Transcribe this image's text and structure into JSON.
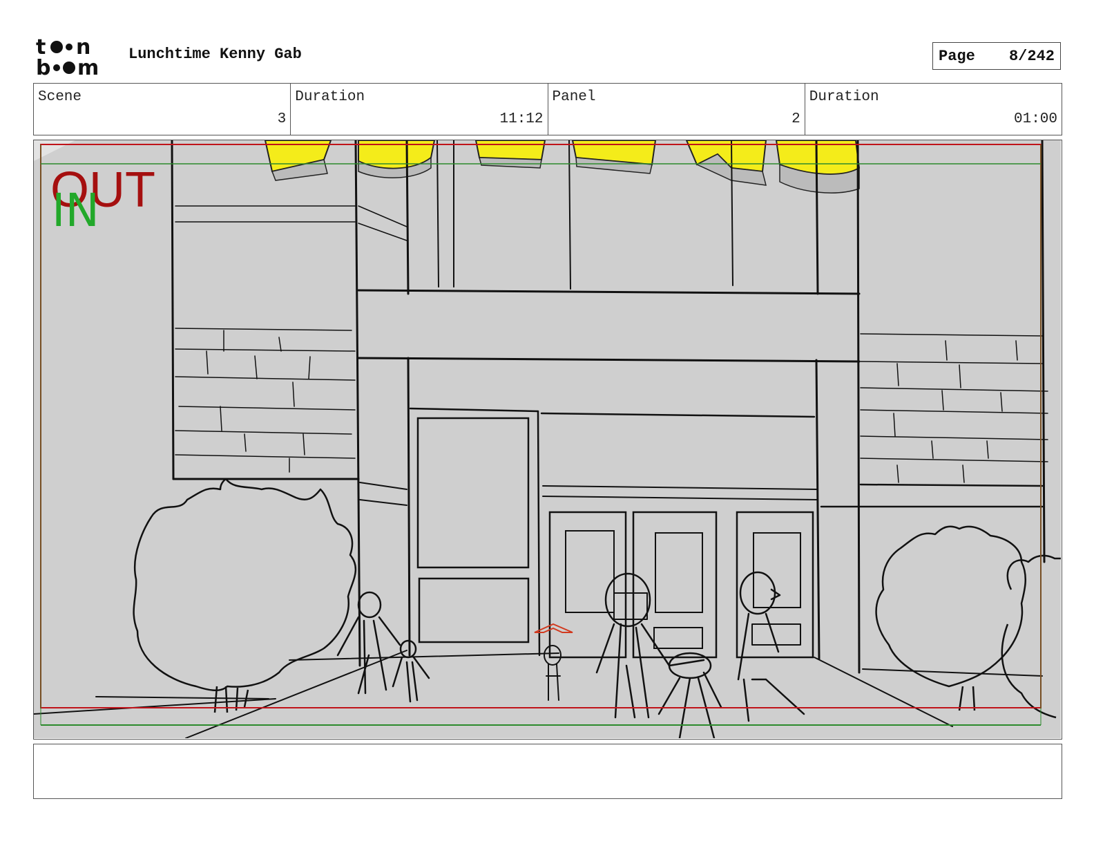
{
  "header": {
    "logo_text": "toon boom",
    "project_title": "Lunchtime Kenny Gab",
    "page_label": "Page",
    "page_value": "8/242"
  },
  "info": {
    "scene_label": "Scene",
    "scene_value": "3",
    "scene_duration_label": "Duration",
    "scene_duration_value": "11:12",
    "panel_label": "Panel",
    "panel_value": "2",
    "panel_duration_label": "Duration",
    "panel_duration_value": "01:00"
  },
  "panel": {
    "out_marker": "OUT",
    "in_marker": "IN",
    "colors": {
      "out_marker": "#a50f0f",
      "in_marker": "#22a82a",
      "safe_frame_red": "#c0131a",
      "safe_frame_green": "#2c8a2c",
      "background": "#cfcfcf",
      "sign_yellow": "#f4ec1a"
    }
  },
  "notes": {
    "text": ""
  }
}
